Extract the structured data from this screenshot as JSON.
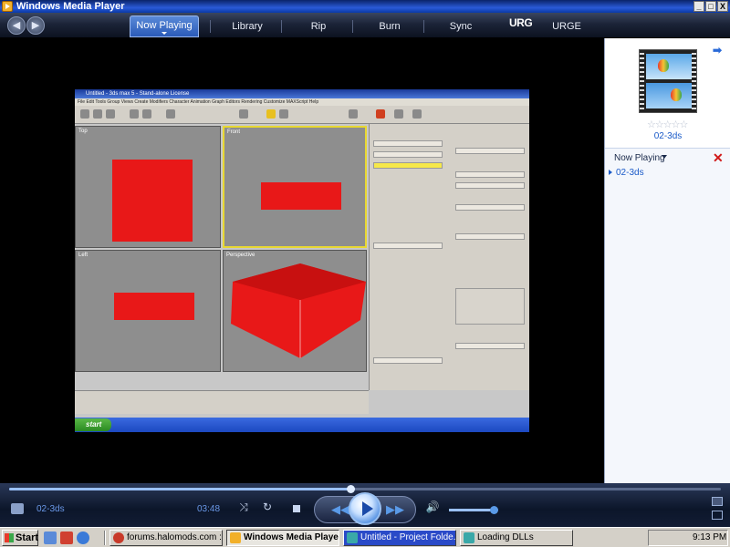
{
  "window": {
    "title": "Windows Media Player",
    "minimize": "_",
    "maximize": "□",
    "close": "X"
  },
  "nav": {
    "back": "◀",
    "forward": "▶",
    "tabs": [
      "Now Playing",
      "Library",
      "Rip",
      "Burn",
      "Sync",
      "URGE"
    ],
    "urge_logo": "URG"
  },
  "video": {
    "app_title": "Untitled - 3ds max 5 - Stand-alone License",
    "menu": "File  Edit  Tools  Group  Views  Create  Modifiers  Character  Animation  Graph Editors  Rendering  Customize  MAXScript  Help",
    "viewports": [
      "Top",
      "Front",
      "Left",
      "Perspective"
    ],
    "start_label": "start"
  },
  "right_panel": {
    "next_arrow": "➡",
    "rating_stars": "☆☆☆☆☆",
    "album_name": "02-3ds",
    "playlist_label": "Now Playing",
    "close_icon": "✕",
    "playlist_items": [
      "02-3ds"
    ]
  },
  "controls": {
    "track_title": "02-3ds",
    "time": "03:48",
    "seek_progress": 0.48,
    "volume_level": 0.9,
    "prev": "◀◀",
    "next": "▶▶",
    "shuffle": "⤨",
    "repeat": "↻",
    "mute": "🔊"
  },
  "taskbar": {
    "start": "Start",
    "buttons": [
      {
        "label": "forums.halomods.com :: Vi...",
        "active": false
      },
      {
        "label": "Windows Media Player",
        "active": true
      },
      {
        "label": "Untitled     - Project Folde...",
        "active": false
      },
      {
        "label": "Loading DLLs",
        "active": false
      }
    ],
    "clock": "9:13 PM"
  },
  "colors": {
    "accent": "#2a5ab8",
    "link": "#1a5ac8",
    "mesh_red": "#e81818"
  }
}
